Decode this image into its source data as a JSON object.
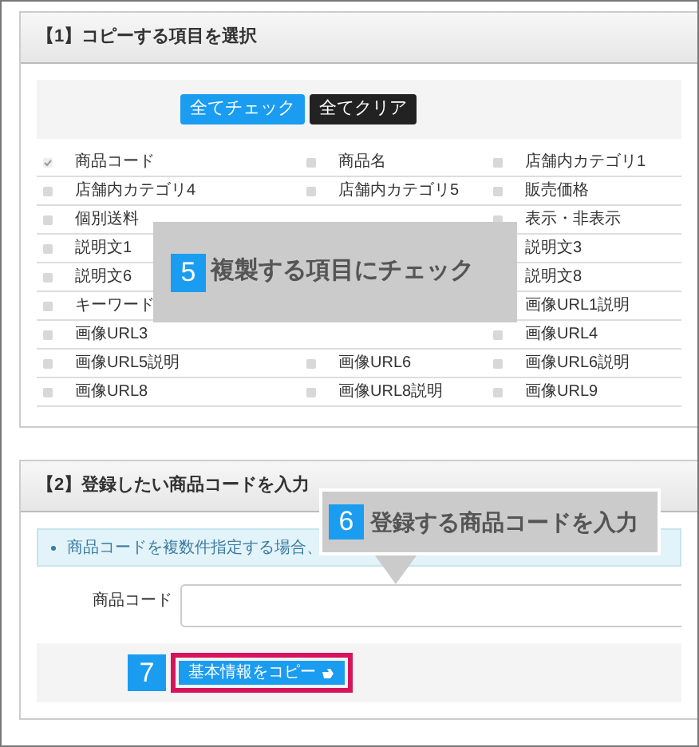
{
  "section1": {
    "title": "【1】コピーする項目を選択",
    "buttons": [
      {
        "label": "全てチェック",
        "kind": "primary"
      },
      {
        "label": "全てクリア",
        "kind": "dark"
      }
    ],
    "rows": [
      [
        {
          "label": "商品コード",
          "checked": true
        },
        {
          "label": "商品名",
          "checked": false
        },
        {
          "label": "店舗内カテゴリ1",
          "checked": false
        }
      ],
      [
        {
          "label": "店舗内カテゴリ4",
          "checked": false
        },
        {
          "label": "店舗内カテゴリ5",
          "checked": false
        },
        {
          "label": "販売価格",
          "checked": false
        }
      ],
      [
        {
          "label": "個別送料",
          "checked": false
        },
        null,
        {
          "label": "表示・非表示",
          "checked": false
        }
      ],
      [
        {
          "label": "説明文1",
          "checked": false
        },
        null,
        {
          "label": "説明文3"
        }
      ],
      [
        {
          "label": "説明文6",
          "checked": false
        },
        null,
        {
          "label": "説明文8"
        }
      ],
      [
        {
          "label": "キーワード",
          "checked": false
        },
        null,
        {
          "label": "画像URL1説明"
        }
      ],
      [
        {
          "label": "画像URL3",
          "checked": false
        },
        null,
        {
          "label": "画像URL4",
          "checked": false
        }
      ],
      [
        {
          "label": "画像URL5説明",
          "checked": false
        },
        {
          "label": "画像URL6",
          "checked": false
        },
        {
          "label": "画像URL6説明",
          "checked": false
        }
      ],
      [
        {
          "label": "画像URL8",
          "checked": false
        },
        {
          "label": "画像URL8説明",
          "checked": false
        },
        {
          "label": "画像URL9",
          "checked": false
        }
      ]
    ],
    "callout": {
      "number": "5",
      "text": "複製する項目にチェック"
    }
  },
  "section2": {
    "title": "【2】登録したい商品コードを入力",
    "info": "商品コードを複数件指定する場合、",
    "field_label": "商品コード",
    "callout": {
      "number": "6",
      "text": "登録する商品コードを入力"
    },
    "submit": {
      "number": "7",
      "label": "基本情報をコピー"
    }
  }
}
